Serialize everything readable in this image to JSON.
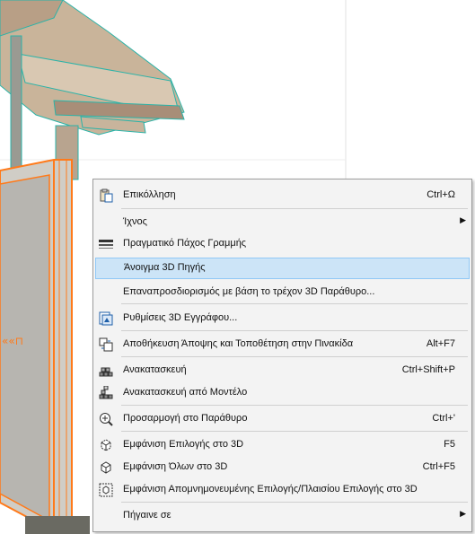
{
  "menu": {
    "items": [
      {
        "label": "Επικόλληση",
        "shortcut": "Ctrl+Ω",
        "icon": "paste-icon"
      },
      {
        "label": "Ίχνος",
        "submenu": true
      },
      {
        "label": "Πραγματικό Πάχος Γραμμής",
        "icon": "line-weight-icon"
      },
      {
        "label": "Άνοιγμα 3D Πηγής",
        "highlighted": true
      },
      {
        "label": "Επαναπροσδιορισμός με βάση το τρέχον 3D Παράθυρο..."
      },
      {
        "label": "Ρυθμίσεις 3D Εγγράφου...",
        "icon": "3d-document-settings-icon"
      },
      {
        "label": "Αποθήκευση Άποψης και Τοποθέτηση στην Πινακίδα",
        "shortcut": "Alt+F7",
        "icon": "save-view-icon"
      },
      {
        "label": "Ανακατασκευή",
        "shortcut": "Ctrl+Shift+P",
        "icon": "rebuild-icon"
      },
      {
        "label": "Ανακατασκευή από Μοντέλο",
        "icon": "rebuild-from-model-icon"
      },
      {
        "label": "Προσαρμογή στο Παράθυρο",
        "shortcut": "Ctrl+'",
        "icon": "fit-in-window-icon"
      },
      {
        "label": "Εμφάνιση Επιλογής στο 3D",
        "shortcut": "F5",
        "icon": "show-selection-3d-icon"
      },
      {
        "label": "Εμφάνιση Όλων στο 3D",
        "shortcut": "Ctrl+F5",
        "icon": "show-all-3d-icon"
      },
      {
        "label": "Εμφάνιση Απομνημονευμένης Επιλογής/Πλαισίου Επιλογής στο 3D",
        "icon": "show-stored-marquee-3d-icon"
      },
      {
        "label": "Πήγαινε σε",
        "submenu": true
      }
    ]
  }
}
